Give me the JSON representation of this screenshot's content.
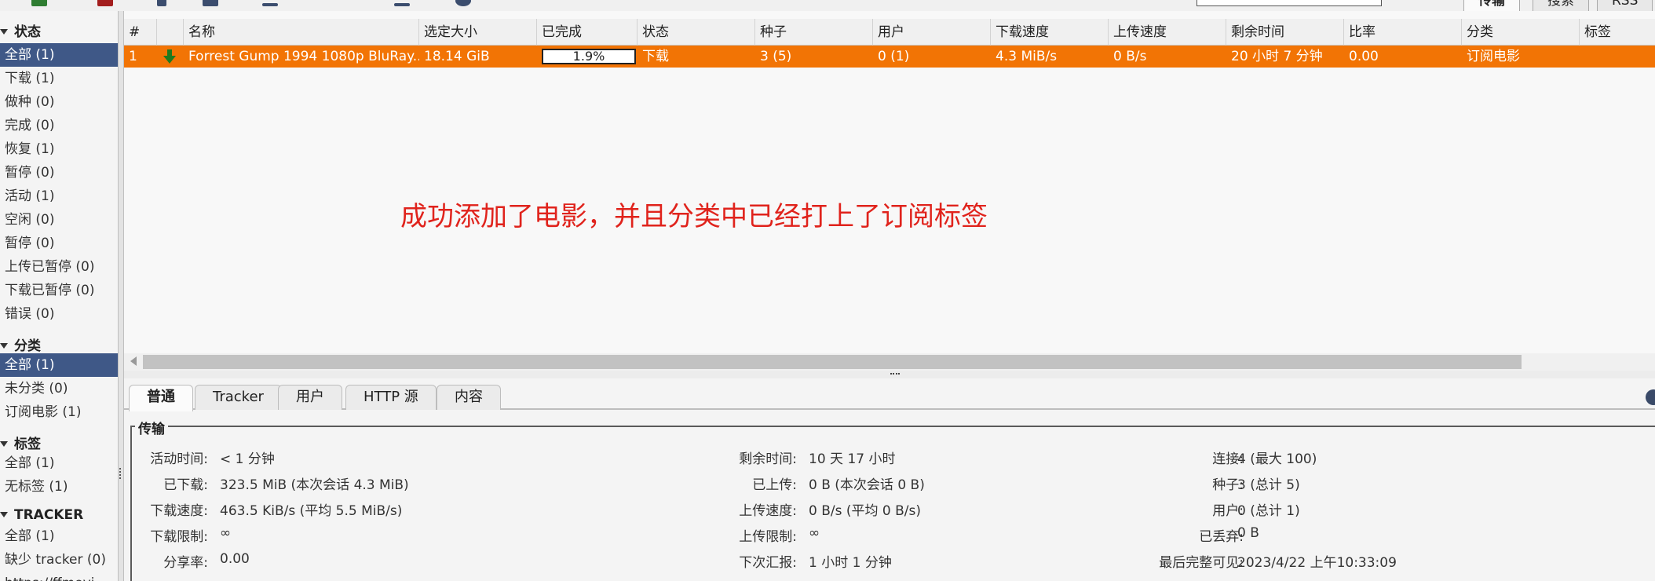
{
  "toolbar": {
    "top_tabs": [
      "传输",
      "搜索",
      "RSS"
    ]
  },
  "sidebar": {
    "status_title": "状态",
    "status_items": [
      {
        "label": "全部 (1)",
        "selected": true
      },
      {
        "label": "下载 (1)"
      },
      {
        "label": "做种 (0)"
      },
      {
        "label": "完成 (0)"
      },
      {
        "label": "恢复 (1)"
      },
      {
        "label": "暂停 (0)"
      },
      {
        "label": "活动 (1)"
      },
      {
        "label": "空闲 (0)"
      },
      {
        "label": "暂停 (0)"
      },
      {
        "label": "上传已暂停 (0)"
      },
      {
        "label": "下载已暂停 (0)"
      },
      {
        "label": "错误 (0)"
      }
    ],
    "category_title": "分类",
    "category_items": [
      {
        "label": "全部 (1)",
        "selected": true
      },
      {
        "label": "未分类 (0)"
      },
      {
        "label": "订阅电影 (1)"
      }
    ],
    "tag_title": "标签",
    "tag_items": [
      {
        "label": "全部 (1)"
      },
      {
        "label": "无标签 (1)"
      }
    ],
    "tracker_title": "TRACKER",
    "tracker_items": [
      {
        "label": "全部 (1)"
      },
      {
        "label": "缺少 tracker (0)"
      },
      {
        "label": "https://ffmovi..."
      }
    ]
  },
  "table": {
    "columns": [
      "#",
      "",
      "名称",
      "选定大小",
      "已完成",
      "状态",
      "种子",
      "用户",
      "下载速度",
      "上传速度",
      "剩余时间",
      "比率",
      "分类",
      "标签"
    ],
    "rows": [
      {
        "num": "1",
        "name": "Forrest Gump 1994 1080p BluRay...",
        "size": "18.14 GiB",
        "progress": "1.9%",
        "progress_value": 1.9,
        "status": "下载",
        "seeds": "3 (5)",
        "peers": "0 (1)",
        "down_speed": "4.3 MiB/s",
        "up_speed": "0 B/s",
        "eta": "20 小时 7 分钟",
        "ratio": "0.00",
        "category": "订阅电影",
        "tags": ""
      }
    ]
  },
  "annotation": "成功添加了电影，并且分类中已经打上了订阅标签",
  "colors": {
    "row_highlight": "#f27405",
    "sidebar_selected": "#3f5887",
    "annotation": "#e0231c"
  },
  "detail_tabs": [
    "普通",
    "Tracker",
    "用户",
    "HTTP 源",
    "内容"
  ],
  "transfer": {
    "title": "传输",
    "col1": [
      {
        "label": "活动时间:",
        "value": "< 1 分钟"
      },
      {
        "label": "已下载:",
        "value": "323.5 MiB (本次会话 4.3 MiB)"
      },
      {
        "label": "下载速度:",
        "value": "463.5 KiB/s (平均 5.5 MiB/s)"
      },
      {
        "label": "下载限制:",
        "value": "∞"
      },
      {
        "label": "分享率:",
        "value": "0.00"
      }
    ],
    "col2": [
      {
        "label": "剩余时间:",
        "value": "10 天 17 小时"
      },
      {
        "label": "已上传:",
        "value": "0 B (本次会话 0 B)"
      },
      {
        "label": "上传速度:",
        "value": "0 B/s (平均 0 B/s)"
      },
      {
        "label": "上传限制:",
        "value": "∞"
      },
      {
        "label": "下次汇报:",
        "value": "1 小时 1 分钟"
      }
    ],
    "col3": [
      {
        "label": "连接:",
        "value": "4 (最大 100)"
      },
      {
        "label": "种子:",
        "value": "3 (总计 5)"
      },
      {
        "label": "用户:",
        "value": "0 (总计 1)"
      },
      {
        "label": "已丢弃:",
        "value": "0 B"
      },
      {
        "label": "最后完整可见:",
        "value": "2023/4/22 上午10:33:09"
      }
    ]
  }
}
